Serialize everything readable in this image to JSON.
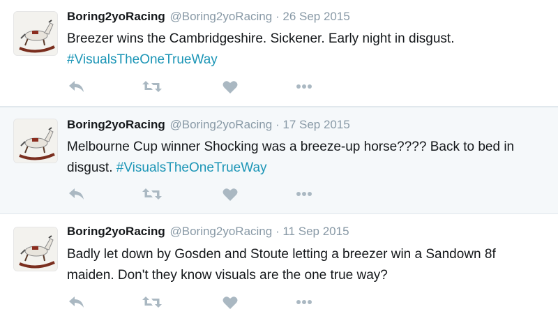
{
  "tweets": [
    {
      "name": "Boring2yoRacing",
      "handle": "@Boring2yoRacing",
      "sep": "·",
      "date": "26 Sep 2015",
      "text": "Breezer wins the Cambridgeshire. Sickener. Early night in disgust. ",
      "hashtag": "#VisualsTheOneTrueWay"
    },
    {
      "name": "Boring2yoRacing",
      "handle": "@Boring2yoRacing",
      "sep": "·",
      "date": "17 Sep 2015",
      "text": "Melbourne Cup winner Shocking was a breeze-up horse???? Back to bed in disgust. ",
      "hashtag": "#VisualsTheOneTrueWay"
    },
    {
      "name": "Boring2yoRacing",
      "handle": "@Boring2yoRacing",
      "sep": "·",
      "date": "11 Sep 2015",
      "text": "Badly let down by Gosden and Stoute letting a breezer win a Sandown 8f maiden. Don't they know visuals are the one true way?",
      "hashtag": ""
    }
  ],
  "icons": {
    "reply": "reply-icon",
    "retweet": "retweet-icon",
    "like": "heart-icon",
    "more": "more-icon",
    "avatar": "rocking-horse-avatar"
  },
  "colors": {
    "hashtag": "#1b95b6",
    "icon": "#aab8c2",
    "meta": "#8899a6",
    "highlight_bg": "#f5f8fa"
  }
}
